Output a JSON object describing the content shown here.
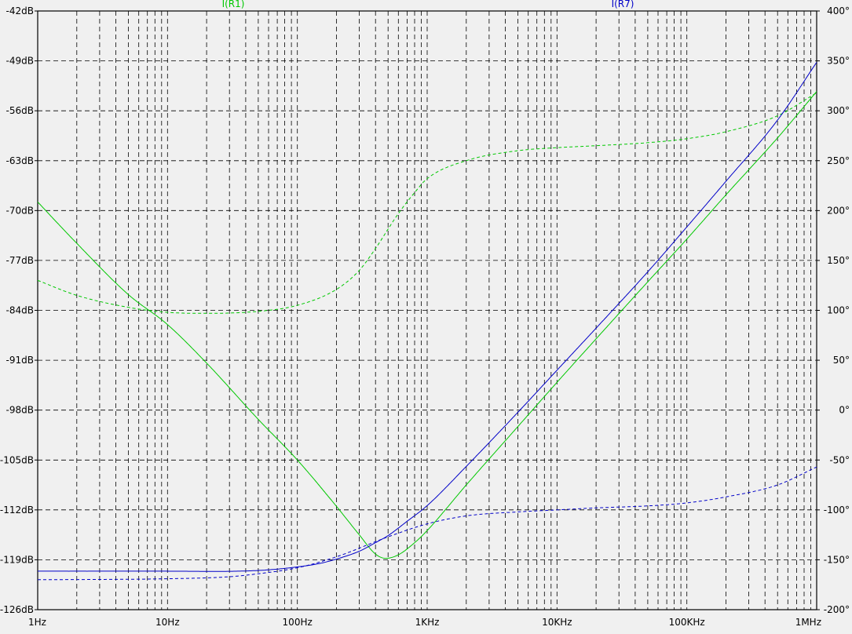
{
  "chart_data": {
    "type": "line",
    "x_scale": "log",
    "xlim": [
      1,
      1000000
    ],
    "grid": true,
    "x_ticks": [
      "1Hz",
      "10Hz",
      "100Hz",
      "1KHz",
      "10KHz",
      "100KHz",
      "1MHz"
    ],
    "x_tick_values": [
      1,
      10,
      100,
      1000,
      10000,
      100000,
      1000000
    ],
    "y_left": {
      "ylim": [
        -126,
        -42
      ],
      "ticks": [
        "-42dB",
        "-49dB",
        "-56dB",
        "-63dB",
        "-70dB",
        "-77dB",
        "-84dB",
        "-91dB",
        "-98dB",
        "-105dB",
        "-112dB",
        "-119dB",
        "-126dB"
      ],
      "tick_values": [
        -42,
        -49,
        -56,
        -63,
        -70,
        -77,
        -84,
        -91,
        -98,
        -105,
        -112,
        -119,
        -126
      ]
    },
    "y_right": {
      "ylim": [
        -200,
        400
      ],
      "ticks": [
        "400°",
        "350°",
        "300°",
        "250°",
        "200°",
        "150°",
        "100°",
        "50°",
        "0°",
        "-50°",
        "-100°",
        "-150°",
        "-200°"
      ],
      "tick_values": [
        400,
        350,
        300,
        250,
        200,
        150,
        100,
        50,
        0,
        -50,
        -100,
        -150,
        -200
      ]
    },
    "series": [
      {
        "name": "I(R1)",
        "color": "#00c800",
        "magnitude_db": {
          "x": [
            1,
            2,
            5,
            10,
            20,
            50,
            100,
            200,
            300,
            400,
            480,
            600,
            800,
            1000,
            2000,
            5000,
            10000,
            20000,
            50000,
            100000,
            200000,
            500000,
            1000000
          ],
          "y": [
            -68.8,
            -74.6,
            -81.8,
            -86.0,
            -91.4,
            -99.3,
            -105.0,
            -111.5,
            -115.5,
            -118.2,
            -118.8,
            -118.3,
            -116.6,
            -114.9,
            -108.5,
            -100.3,
            -94.1,
            -88.0,
            -80.0,
            -74.0,
            -67.8,
            -59.8,
            -53.3
          ]
        },
        "phase_deg": {
          "x": [
            1,
            2,
            5,
            10,
            20,
            50,
            100,
            200,
            300,
            400,
            600,
            800,
            1000,
            2000,
            5000,
            10000,
            20000,
            50000,
            100000,
            200000,
            500000,
            1000000
          ],
          "y": [
            130,
            115,
            103,
            98,
            97,
            99,
            105,
            121,
            140,
            162,
            197,
            218,
            232,
            250,
            260,
            263,
            265,
            268,
            272,
            279,
            295,
            318
          ]
        }
      },
      {
        "name": "I(R7)",
        "color": "#0000c8",
        "magnitude_db": {
          "x": [
            1,
            10,
            50,
            100,
            150,
            200,
            300,
            400,
            500,
            700,
            1000,
            2000,
            5000,
            10000,
            20000,
            50000,
            100000,
            200000,
            500000,
            1000000
          ],
          "y": [
            -120.6,
            -120.6,
            -120.5,
            -120.0,
            -119.5,
            -118.9,
            -117.8,
            -116.6,
            -115.6,
            -113.6,
            -111.4,
            -105.9,
            -98.3,
            -92.4,
            -86.5,
            -78.6,
            -72.3,
            -65.9,
            -57.3,
            -49.2
          ]
        },
        "phase_deg": {
          "x": [
            1,
            10,
            30,
            50,
            100,
            200,
            500,
            1000,
            2000,
            5000,
            10000,
            20000,
            50000,
            100000,
            200000,
            500000,
            1000000
          ],
          "y": [
            -170,
            -169,
            -167,
            -164,
            -158,
            -147,
            -127,
            -114,
            -106,
            -102,
            -100,
            -98,
            -96,
            -93,
            -87,
            -75,
            -57
          ]
        }
      }
    ]
  }
}
